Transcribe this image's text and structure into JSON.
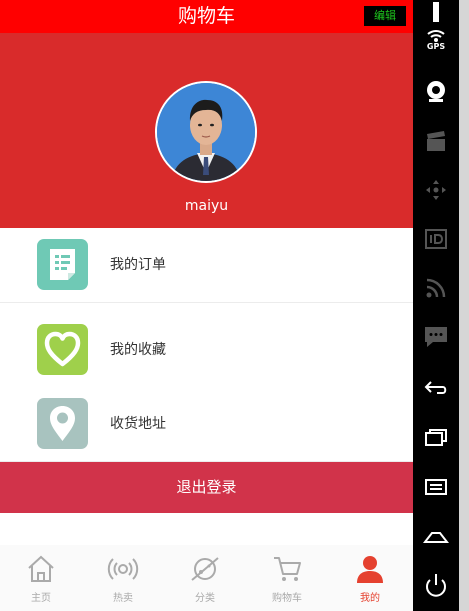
{
  "header": {
    "title": "购物车",
    "edit_label": "编辑"
  },
  "profile": {
    "username": "maiyu"
  },
  "menu": [
    {
      "label": "我的订单",
      "icon": "order-list-icon",
      "color": "#6fc9b5"
    },
    {
      "label": "我的收藏",
      "icon": "heart-icon",
      "color": "#9fd04b"
    },
    {
      "label": "收货地址",
      "icon": "location-pin-icon",
      "color": "#a8c3bf"
    }
  ],
  "logout_label": "退出登录",
  "tabs": [
    {
      "label": "主页",
      "icon": "home-icon",
      "active": false
    },
    {
      "label": "热卖",
      "icon": "broadcast-icon",
      "active": false
    },
    {
      "label": "分类",
      "icon": "planet-icon",
      "active": false
    },
    {
      "label": "购物车",
      "icon": "cart-icon",
      "active": false
    },
    {
      "label": "我的",
      "icon": "user-icon",
      "active": true
    }
  ],
  "emulator_sidebar": {
    "gps_label": "GPS"
  },
  "colors": {
    "header_red": "#ff0000",
    "profile_red": "#d92b2b",
    "logout_red": "#d1334a",
    "active_tab": "#e5412f",
    "inactive_tab": "#aaaaaa"
  }
}
